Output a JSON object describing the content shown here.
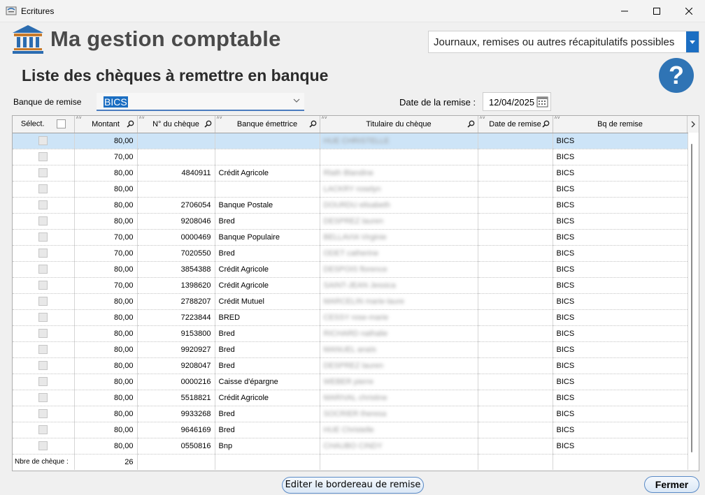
{
  "window": {
    "title": "Ecritures"
  },
  "header": {
    "app_title": "Ma gestion comptable",
    "subtitle": "Liste des chèques à remettre en banque",
    "journal_combo": "Journaux, remises ou autres récapitulatifs possibles",
    "help": "?"
  },
  "form": {
    "banque_label": "Banque de remise",
    "banque_value": "BICS",
    "date_label": "Date de la remise :",
    "date_value": "12/04/2025"
  },
  "table": {
    "columns": {
      "select": "Sélect.",
      "montant": "Montant",
      "numero": "N° du chèque",
      "banque": "Banque émettrice",
      "titulaire": "Titulaire du chèque",
      "date": "Date de remise",
      "bq_remise": "Bq de remise"
    },
    "rows": [
      [
        "80,00",
        "",
        "",
        "HUE CHRISTELLE",
        "",
        "BICS"
      ],
      [
        "70,00",
        "",
        "",
        "",
        "",
        "BICS"
      ],
      [
        "80,00",
        "4840911",
        "Crédit Agricole",
        "Rlath Blandine",
        "",
        "BICS"
      ],
      [
        "80,00",
        "",
        "",
        "LACKRY roselyn",
        "",
        "BICS"
      ],
      [
        "80,00",
        "2706054",
        "Banque Postale",
        "DOURDU elisabeth",
        "",
        "BICS"
      ],
      [
        "80,00",
        "9208046",
        "Bred",
        "DESPREZ lauren",
        "",
        "BICS"
      ],
      [
        "70,00",
        "0000469",
        "Banque Populaire",
        "BELLAVIA Virginie",
        "",
        "BICS"
      ],
      [
        "70,00",
        "7020550",
        "Bred",
        "ODET catherine",
        "",
        "BICS"
      ],
      [
        "80,00",
        "3854388",
        "Crédit Agricole",
        "DESPOIS florence",
        "",
        "BICS"
      ],
      [
        "70,00",
        "1398620",
        "Crédit Agricole",
        "SAINT-JEAN Jessica",
        "",
        "BICS"
      ],
      [
        "80,00",
        "2788207",
        "Crédit Mutuel",
        "MARCELIN marie-laure",
        "",
        "BICS"
      ],
      [
        "80,00",
        "7223844",
        "BRED",
        "CESSY rose-marie",
        "",
        "BICS"
      ],
      [
        "80,00",
        "9153800",
        "Bred",
        "RICHARD nathalie",
        "",
        "BICS"
      ],
      [
        "80,00",
        "9920927",
        "Bred",
        "MANUEL anaïs",
        "",
        "BICS"
      ],
      [
        "80,00",
        "9208047",
        "Bred",
        "DESPREZ lauren",
        "",
        "BICS"
      ],
      [
        "80,00",
        "0000216",
        "Caisse d'épargne",
        "WEBER pierre",
        "",
        "BICS"
      ],
      [
        "80,00",
        "5518821",
        "Crédit Agricole",
        "MARIVAL christine",
        "",
        "BICS"
      ],
      [
        "80,00",
        "9933268",
        "Bred",
        "SOCRIER theresa",
        "",
        "BICS"
      ],
      [
        "80,00",
        "9646169",
        "Bred",
        "HUE Christelle",
        "",
        "BICS"
      ],
      [
        "80,00",
        "0550816",
        "Bnp",
        "CHAUBO CINDY",
        "",
        "BICS"
      ]
    ],
    "footer_label": "Nbre de chèque :",
    "footer_count": "26"
  },
  "buttons": {
    "edit": "Editer le bordereau de remise",
    "close": "Fermer"
  },
  "colors": {
    "accent": "#1b6ec2",
    "selection": "#cde4f7",
    "help": "#2f74b5"
  }
}
